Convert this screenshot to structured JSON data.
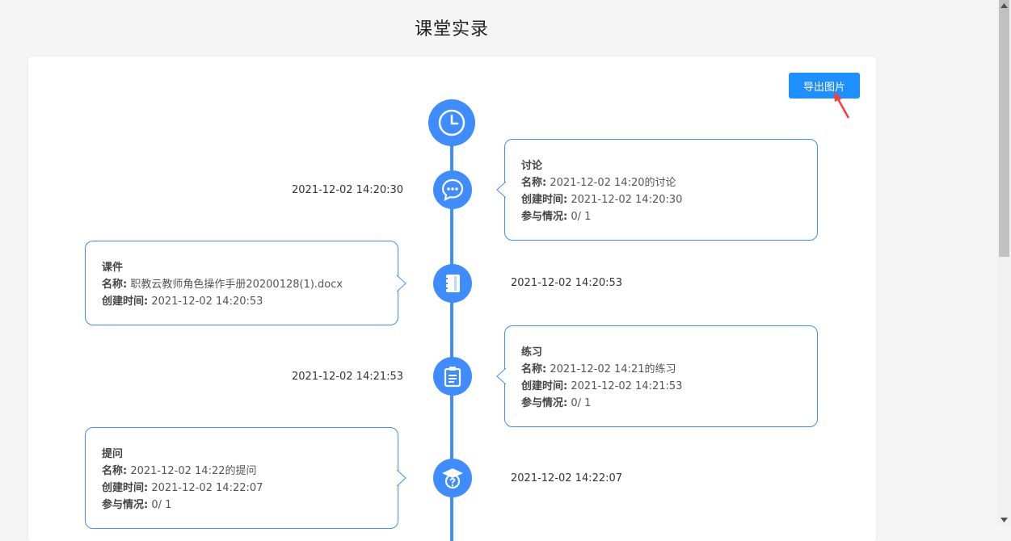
{
  "page_title": "课堂实录",
  "export_button": "导出图片",
  "labels": {
    "name": "名称:",
    "created": "创建时间:",
    "participation": "参与情况:"
  },
  "events": [
    {
      "type": "讨论",
      "icon": "chat-bubble-icon",
      "time": "2021-12-02 14:20:30",
      "name": "2021-12-02 14:20的讨论",
      "created": "2021-12-02 14:20:30",
      "participation": "0/ 1"
    },
    {
      "type": "课件",
      "icon": "notebook-icon",
      "time": "2021-12-02 14:20:53",
      "name": "职教云教师角色操作手册20200128(1).docx",
      "created": "2021-12-02 14:20:53"
    },
    {
      "type": "练习",
      "icon": "clipboard-icon",
      "time": "2021-12-02 14:21:53",
      "name": "2021-12-02 14:21的练习",
      "created": "2021-12-02 14:21:53",
      "participation": "0/ 1"
    },
    {
      "type": "提问",
      "icon": "question-cap-icon",
      "time": "2021-12-02 14:22:07",
      "name": "2021-12-02 14:22的提问",
      "created": "2021-12-02 14:22:07",
      "participation": "0/ 1"
    }
  ],
  "colors": {
    "accent": "#3f8cff",
    "button": "#1e8fff",
    "annotation_arrow": "#ff3b3b"
  }
}
